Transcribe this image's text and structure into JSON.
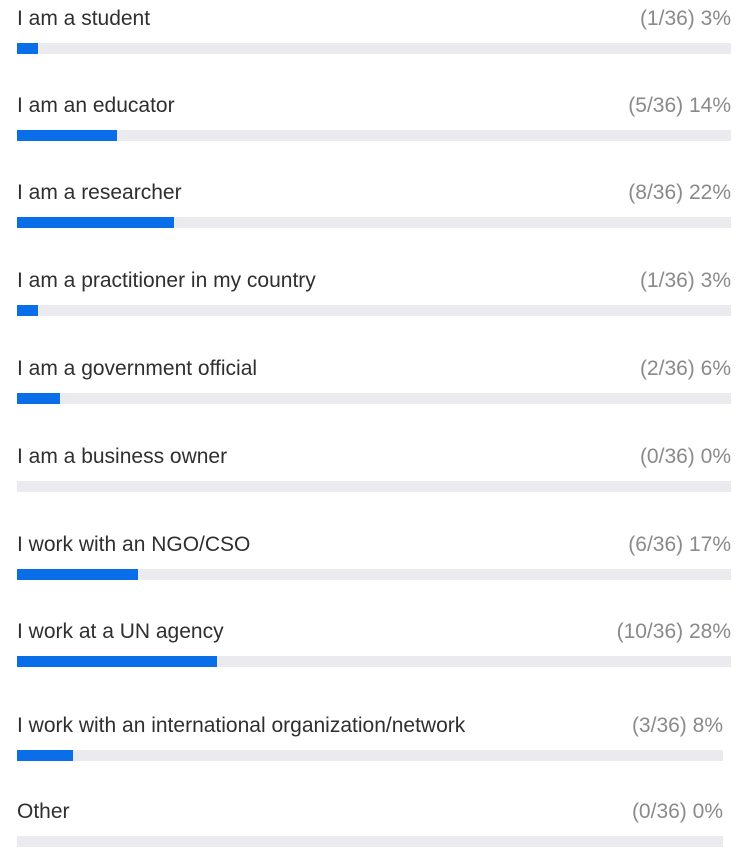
{
  "poll": {
    "options": [
      {
        "label": "I am a student",
        "count": "(1/36)",
        "percent": "3%",
        "fraction": 0.03
      },
      {
        "label": "I am an educator",
        "count": "(5/36)",
        "percent": "14%",
        "fraction": 0.14
      },
      {
        "label": "I am a researcher",
        "count": "(8/36)",
        "percent": "22%",
        "fraction": 0.22
      },
      {
        "label": "I am a practitioner in my country",
        "count": "(1/36)",
        "percent": "3%",
        "fraction": 0.03
      },
      {
        "label": "I am a government official",
        "count": "(2/36)",
        "percent": "6%",
        "fraction": 0.06
      },
      {
        "label": "I am a business owner",
        "count": "(0/36)",
        "percent": "0%",
        "fraction": 0.0
      },
      {
        "label": "I work with an NGO/CSO",
        "count": "(6/36)",
        "percent": "17%",
        "fraction": 0.17
      },
      {
        "label": "I work at a UN agency",
        "count": "(10/36)",
        "percent": "28%",
        "fraction": 0.28
      },
      {
        "label": "I work with an international organization/network",
        "count": "(3/36)",
        "percent": "8%",
        "fraction": 0.08
      },
      {
        "label": "Other",
        "count": "(0/36)",
        "percent": "0%",
        "fraction": 0.0
      }
    ]
  },
  "colors": {
    "bar_fill": "#0a6ee8",
    "bar_track": "#ebebef",
    "label_text": "#2f2f2f",
    "stat_text": "#8a8a8a"
  }
}
